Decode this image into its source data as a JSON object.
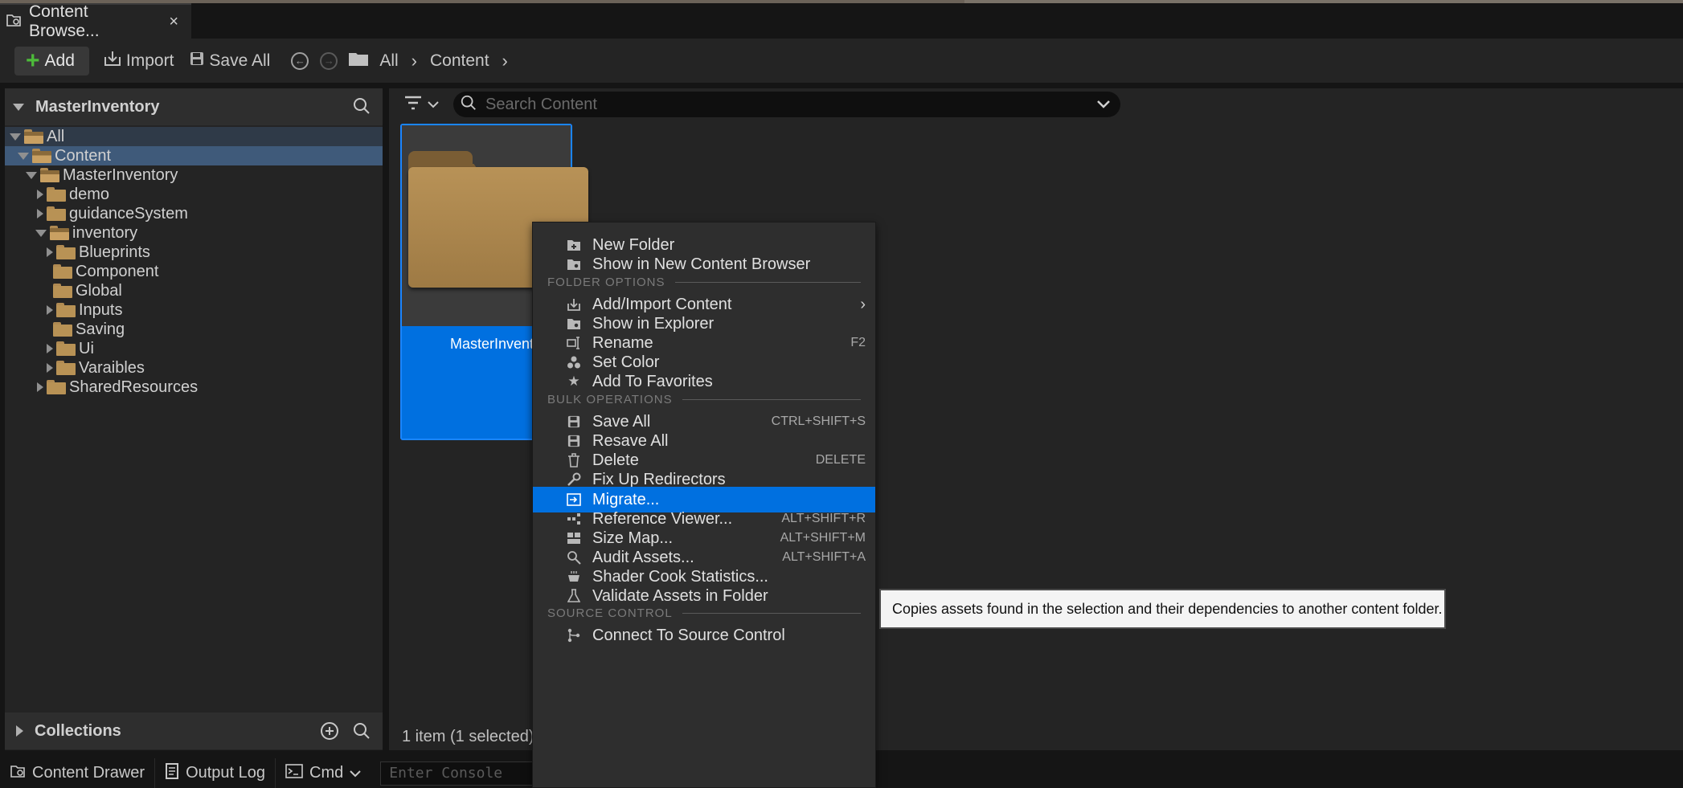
{
  "tab": {
    "title": "Content Browse...",
    "close": "×"
  },
  "toolbar": {
    "add_label": "Add",
    "import_label": "Import",
    "save_all_label": "Save All",
    "breadcrumbs": [
      "All",
      "Content"
    ]
  },
  "sidebar": {
    "header": "MasterInventory",
    "tree": [
      {
        "label": "All",
        "depth": 0,
        "state": "expanded"
      },
      {
        "label": "Content",
        "depth": 1,
        "state": "expanded"
      },
      {
        "label": "MasterInventory",
        "depth": 2,
        "state": "expanded"
      },
      {
        "label": "demo",
        "depth": 3,
        "state": "collapsed"
      },
      {
        "label": "guidanceSystem",
        "depth": 3,
        "state": "collapsed"
      },
      {
        "label": "inventory",
        "depth": 3,
        "state": "expanded"
      },
      {
        "label": "Blueprints",
        "depth": 4,
        "state": "collapsed"
      },
      {
        "label": "Component",
        "depth": 4,
        "state": "leaf"
      },
      {
        "label": "Global",
        "depth": 4,
        "state": "leaf"
      },
      {
        "label": "Inputs",
        "depth": 4,
        "state": "collapsed"
      },
      {
        "label": "Saving",
        "depth": 4,
        "state": "leaf"
      },
      {
        "label": "Ui",
        "depth": 4,
        "state": "collapsed"
      },
      {
        "label": "Varaibles",
        "depth": 4,
        "state": "collapsed"
      },
      {
        "label": "SharedResources",
        "depth": 3,
        "state": "collapsed"
      }
    ],
    "collections_label": "Collections"
  },
  "main": {
    "search_placeholder": "Search Content",
    "tile_name": "MasterInvent",
    "item_count": "1 item (1 selected)"
  },
  "context_menu": {
    "items": [
      {
        "label": "New Folder",
        "icon": "new-folder-icon"
      },
      {
        "label": "Show in New Content Browser",
        "icon": "content-browser-icon"
      },
      {
        "section": "FOLDER OPTIONS"
      },
      {
        "label": "Add/Import Content",
        "icon": "import-icon",
        "submenu": "›"
      },
      {
        "label": "Show in Explorer",
        "icon": "explorer-icon"
      },
      {
        "label": "Rename",
        "icon": "rename-icon",
        "shortcut": "F2"
      },
      {
        "label": "Set Color",
        "icon": "color-icon"
      },
      {
        "label": "Add To Favorites",
        "icon": "star-icon"
      },
      {
        "section": "BULK OPERATIONS"
      },
      {
        "label": "Save All",
        "icon": "save-icon",
        "shortcut": "CTRL+SHIFT+S"
      },
      {
        "label": "Resave All",
        "icon": "save-icon"
      },
      {
        "label": "Delete",
        "icon": "trash-icon",
        "shortcut": "DELETE"
      },
      {
        "label": "Fix Up Redirectors",
        "icon": "wrench-icon"
      },
      {
        "label": "Migrate...",
        "icon": "migrate-icon",
        "active": true
      },
      {
        "label": "Reference Viewer...",
        "icon": "reference-icon",
        "shortcut": "ALT+SHIFT+R"
      },
      {
        "label": "Size Map...",
        "icon": "sizemap-icon",
        "shortcut": "ALT+SHIFT+M"
      },
      {
        "label": "Audit Assets...",
        "icon": "audit-icon",
        "shortcut": "ALT+SHIFT+A"
      },
      {
        "label": "Shader Cook Statistics...",
        "icon": "shader-icon"
      },
      {
        "label": "Validate Assets in Folder",
        "icon": "flask-icon"
      },
      {
        "section": "SOURCE CONTROL"
      },
      {
        "label": "Connect To Source Control",
        "icon": "source-control-icon"
      }
    ]
  },
  "tooltip": "Copies assets found in the selection and their dependencies to another content folder.",
  "bottom_bar": {
    "content_drawer": "Content Drawer",
    "output_log": "Output Log",
    "cmd": "Cmd",
    "console_placeholder": "Enter Console"
  },
  "colors": {
    "accent": "#0070e0",
    "add_green": "#4dbb3a",
    "folder": "#b89255",
    "selected_row": "#3f5a7a"
  }
}
